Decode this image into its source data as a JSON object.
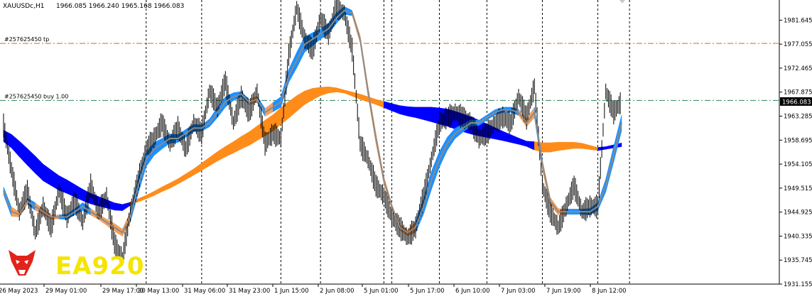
{
  "header": {
    "symbol": "XAUUSDc,H1",
    "ohlc": "1966.085 1966.240 1965.168 1966.083"
  },
  "logo": {
    "text": "EA920",
    "color": "#f5e400",
    "badge_color": "#e2231a"
  },
  "chart_data": {
    "type": "line",
    "title": "XAUUSDc,H1",
    "x": [
      "26 May 2023",
      "29 May 01:00",
      "29 May 17:00",
      "30 May 13:00",
      "31 May 06:00",
      "31 May 23:00",
      "1 Jun 15:00",
      "2 Jun 08:00",
      "5 Jun 01:00",
      "5 Jun 17:00",
      "6 Jun 10:00",
      "7 Jun 03:00",
      "7 Jun 19:00",
      "8 Jun 12:00"
    ],
    "y_ticks": [
      "1981.645",
      "1977.055",
      "1972.465",
      "1967.875",
      "1963.285",
      "1958.695",
      "1954.105",
      "1949.515",
      "1944.925",
      "1940.335",
      "1935.745",
      "1931.155"
    ],
    "ylim": [
      1931.155,
      1985.5
    ],
    "current_price": 1966.083,
    "current_price_label": "1966.083",
    "colors": {
      "bull_band": "#1e90ff",
      "bear_band": "#0000ff",
      "slow_bull": "#ff8c1a",
      "slow_bear": "#ff0000",
      "fast_line": "#8a8a8a",
      "fast_bear": "#f0a060"
    },
    "price": [
      1961.5,
      1953,
      1945,
      1949,
      1941,
      1946,
      1942,
      1949,
      1944,
      1947,
      1943,
      1950,
      1945,
      1948,
      1939,
      1936,
      1945,
      1951,
      1957,
      1959,
      1962,
      1958,
      1961,
      1957,
      1962,
      1960,
      1968,
      1965,
      1970,
      1962,
      1967,
      1964,
      1968,
      1958,
      1960,
      1959,
      1975,
      1984,
      1978,
      1976,
      1982,
      1979,
      1984,
      1983,
      1976,
      1958,
      1955,
      1950,
      1948,
      1944,
      1942,
      1940,
      1942,
      1948,
      1955,
      1962,
      1963,
      1964,
      1963,
      1962,
      1959,
      1960,
      1962,
      1963,
      1962,
      1967,
      1963,
      1969,
      1950,
      1945,
      1942,
      1946,
      1950,
      1945,
      1946,
      1946,
      1968,
      1964,
      1966.1
    ],
    "fast_line": [
      1949,
      1945,
      1944.5,
      1947,
      1946,
      1945,
      1944,
      1944,
      1944,
      1945,
      1946,
      1945,
      1944,
      1943,
      1942,
      1941,
      1944,
      1950,
      1955,
      1957,
      1958,
      1959,
      1959,
      1960,
      1961,
      1961,
      1962,
      1964,
      1966,
      1967,
      1967.5,
      1966,
      1966.5,
      1964,
      1965,
      1966,
      1971,
      1974,
      1977,
      1978,
      1979,
      1980,
      1982,
      1983.5,
      1983,
      1978,
      1968,
      1959,
      1951,
      1946,
      1942,
      1941,
      1942,
      1946,
      1951,
      1955,
      1958,
      1960,
      1961,
      1962,
      1962,
      1963,
      1964,
      1964.5,
      1964.5,
      1964,
      1962,
      1964,
      1954,
      1947,
      1945,
      1945,
      1945,
      1945,
      1945,
      1946,
      1950,
      1956,
      1962
    ],
    "fast_width": [
      1.5,
      1.8,
      1.0,
      1.2,
      1.5,
      1.0,
      0.8,
      0.8,
      1.0,
      1.2,
      1.5,
      1.3,
      1.0,
      1.2,
      1.5,
      1.4,
      2.0,
      3.0,
      2.8,
      2.5,
      2.0,
      1.8,
      1.5,
      1.5,
      1.4,
      1.2,
      1.5,
      2.0,
      2.0,
      1.5,
      1.0,
      1.0,
      1.2,
      1.5,
      1.8,
      2.0,
      2.5,
      3.0,
      3.0,
      2.5,
      2.0,
      2.0,
      2.0,
      1.5,
      1.0,
      1.5,
      2.0,
      2.0,
      1.5,
      1.0,
      1.0,
      1.2,
      2.0,
      3.0,
      3.5,
      3.0,
      2.5,
      2.0,
      1.5,
      1.2,
      1.0,
      1.0,
      1.0,
      1.0,
      1.0,
      1.2,
      1.5,
      2.0,
      2.0,
      1.5,
      1.2,
      1.0,
      1.0,
      1.0,
      1.2,
      1.5,
      2.5,
      3.0,
      3.0
    ],
    "fast_dir": [
      1,
      0,
      0,
      1,
      0,
      0,
      0,
      1,
      1,
      1,
      1,
      0,
      0,
      0,
      0,
      0,
      1,
      1,
      1,
      1,
      1,
      1,
      1,
      1,
      1,
      1,
      1,
      1,
      1,
      1,
      1,
      0,
      1,
      0,
      1,
      1,
      1,
      1,
      1,
      1,
      1,
      1,
      1,
      1,
      0,
      0,
      0,
      0,
      0,
      0,
      0,
      0,
      1,
      1,
      1,
      1,
      1,
      1,
      1,
      1,
      1,
      1,
      1,
      1,
      1,
      0,
      0,
      1,
      0,
      0,
      0,
      1,
      1,
      1,
      1,
      1,
      1,
      1,
      1
    ],
    "slow_line": [
      1959.5,
      1958.5,
      1957,
      1955.5,
      1954,
      1952.5,
      1951.5,
      1950.5,
      1949.8,
      1949,
      1948.2,
      1947.5,
      1947,
      1946.5,
      1946,
      1945.8,
      1946.5,
      1947.2,
      1947.8,
      1948.5,
      1949.3,
      1950,
      1950.8,
      1951.7,
      1952.6,
      1953.6,
      1954.6,
      1955.6,
      1956.5,
      1957.3,
      1958.2,
      1959,
      1960,
      1961,
      1962,
      1963.3,
      1964.5,
      1965.7,
      1966.8,
      1967.5,
      1968,
      1968.3,
      1968.3,
      1968,
      1967.5,
      1967,
      1966.5,
      1966,
      1965.5,
      1965,
      1964.5,
      1964.2,
      1964,
      1963.8,
      1963.6,
      1963.3,
      1963,
      1962.5,
      1962,
      1961.5,
      1961,
      1960.5,
      1960,
      1959.5,
      1959,
      1958.5,
      1958,
      1957.6,
      1957.3,
      1957.3,
      1957.5,
      1957.6,
      1957.7,
      1957.6,
      1957.3,
      1957,
      1957.2,
      1957.5,
      1957.8
    ],
    "slow_width": [
      2.2,
      2.6,
      3.0,
      3.2,
      3.3,
      3.2,
      3.0,
      2.8,
      2.6,
      2.4,
      2.2,
      2.0,
      1.8,
      1.6,
      1.4,
      1.2,
      0.6,
      0.6,
      0.7,
      0.8,
      0.9,
      1.0,
      1.0,
      1.1,
      1.2,
      1.4,
      1.6,
      1.8,
      2.0,
      2.2,
      2.4,
      2.6,
      2.8,
      3.0,
      3.1,
      3.2,
      3.2,
      3.0,
      2.6,
      2.2,
      1.6,
      1.2,
      0.8,
      0.6,
      0.8,
      1.0,
      1.0,
      1.0,
      1.2,
      1.4,
      1.6,
      1.8,
      2.0,
      2.4,
      2.8,
      3.1,
      3.3,
      3.4,
      3.4,
      3.3,
      3.0,
      2.6,
      2.2,
      1.8,
      1.5,
      1.2,
      1.0,
      1.6,
      1.8,
      1.8,
      1.6,
      1.4,
      1.2,
      1.0,
      0.8,
      0.6,
      0.5,
      0.6,
      0.7
    ],
    "slow_dir": [
      0,
      0,
      0,
      0,
      0,
      0,
      0,
      0,
      0,
      0,
      0,
      0,
      0,
      0,
      0,
      0,
      1,
      1,
      1,
      1,
      1,
      1,
      1,
      1,
      1,
      1,
      1,
      1,
      1,
      1,
      1,
      1,
      1,
      1,
      1,
      1,
      1,
      1,
      1,
      1,
      1,
      1,
      1,
      1,
      1,
      1,
      1,
      1,
      0,
      0,
      0,
      0,
      0,
      0,
      0,
      0,
      0,
      0,
      0,
      0,
      0,
      0,
      0,
      0,
      0,
      0,
      0,
      1,
      1,
      1,
      1,
      1,
      1,
      1,
      1,
      0,
      0,
      0,
      0
    ],
    "vlines": [
      18,
      25,
      35,
      40,
      48,
      49,
      55,
      61,
      68,
      75,
      79
    ],
    "hlines": [
      {
        "label": "#257625450 tp",
        "price": 1977.2,
        "color": "#d2691e"
      },
      {
        "label": "#257625450 buy 1.00",
        "price": 1966.3,
        "color": "#2e8b57"
      }
    ]
  }
}
